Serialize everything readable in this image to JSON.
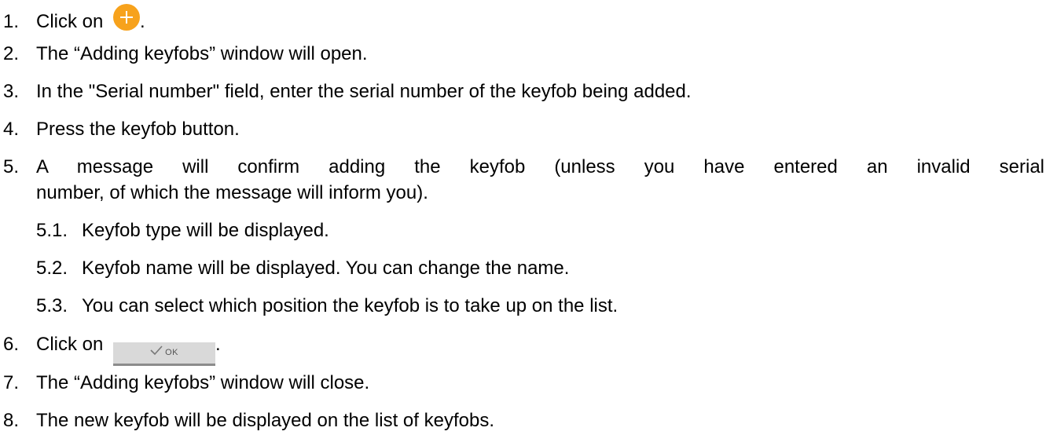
{
  "steps": [
    {
      "num": "1.",
      "text_before": "Click on",
      "text_after": "."
    },
    {
      "num": "2.",
      "text": "The “Adding keyfobs” window will open."
    },
    {
      "num": "3.",
      "text": "In the \"Serial number\" field, enter the serial number of the keyfob being added."
    },
    {
      "num": "4.",
      "text": "Press the keyfob button."
    },
    {
      "num": "5.",
      "text_line1": "A message will confirm adding the keyfob (unless you have entered an invalid serial",
      "text_line2": "number, of which the message will inform you)."
    },
    {
      "num": "6.",
      "text_before": "Click on",
      "text_after": "."
    },
    {
      "num": "7.",
      "text": "The “Adding keyfobs” window will close."
    },
    {
      "num": "8.",
      "text": "The new keyfob will be displayed on the list of keyfobs."
    }
  ],
  "substeps": [
    {
      "num": "5.1.",
      "text": "Keyfob type will be displayed."
    },
    {
      "num": "5.2.",
      "text": "Keyfob name will be displayed. You can change the name."
    },
    {
      "num": "5.3.",
      "text": "You can select which position the keyfob is to take up on the list."
    }
  ],
  "ok_button": {
    "label": "OK"
  },
  "colors": {
    "add_button": "#f7a21c",
    "ok_button_bg": "#d9d9d9"
  },
  "icons": {
    "add": "plus-icon",
    "confirm": "check-icon"
  }
}
